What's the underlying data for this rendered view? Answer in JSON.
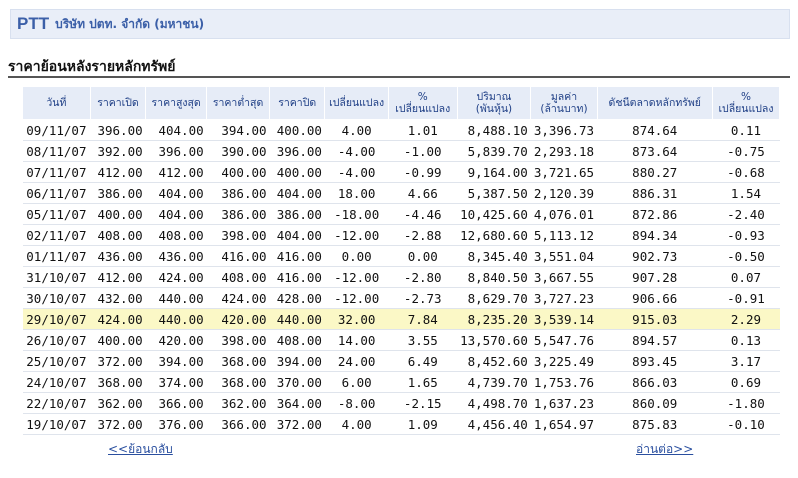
{
  "header": {
    "symbol": "PTT",
    "company_name": "บริษัท ปตท. จำกัด (มหาชน)"
  },
  "section_title": "ราคาย้อนหลังรายหลักทรัพย์",
  "table": {
    "columns": [
      "วันที่",
      "ราคาเปิด",
      "ราคาสูงสุด",
      "ราคาต่ำสุด",
      "ราคาปิด",
      "เปลี่ยนแปลง",
      [
        "%",
        "เปลี่ยนแปลง"
      ],
      [
        "ปริมาณ",
        "(พันหุ้น)"
      ],
      [
        "มูลค่า",
        "(ล้านบาท)"
      ],
      "ดัชนีตลาดหลักทรัพย์",
      [
        "%",
        "เปลี่ยนแปลง"
      ]
    ],
    "highlighted_row": 9,
    "rows": [
      [
        "09/11/07",
        "396.00",
        "404.00",
        "394.00",
        "400.00",
        "4.00",
        "1.01",
        "8,488.10",
        "3,396.73",
        "874.64",
        "0.11"
      ],
      [
        "08/11/07",
        "392.00",
        "396.00",
        "390.00",
        "396.00",
        "-4.00",
        "-1.00",
        "5,839.70",
        "2,293.18",
        "873.64",
        "-0.75"
      ],
      [
        "07/11/07",
        "412.00",
        "412.00",
        "400.00",
        "400.00",
        "-4.00",
        "-0.99",
        "9,164.00",
        "3,721.65",
        "880.27",
        "-0.68"
      ],
      [
        "06/11/07",
        "386.00",
        "404.00",
        "386.00",
        "404.00",
        "18.00",
        "4.66",
        "5,387.50",
        "2,120.39",
        "886.31",
        "1.54"
      ],
      [
        "05/11/07",
        "400.00",
        "404.00",
        "386.00",
        "386.00",
        "-18.00",
        "-4.46",
        "10,425.60",
        "4,076.01",
        "872.86",
        "-2.40"
      ],
      [
        "02/11/07",
        "408.00",
        "408.00",
        "398.00",
        "404.00",
        "-12.00",
        "-2.88",
        "12,680.60",
        "5,113.12",
        "894.34",
        "-0.93"
      ],
      [
        "01/11/07",
        "436.00",
        "436.00",
        "416.00",
        "416.00",
        "0.00",
        "0.00",
        "8,345.40",
        "3,551.04",
        "902.73",
        "-0.50"
      ],
      [
        "31/10/07",
        "412.00",
        "424.00",
        "408.00",
        "416.00",
        "-12.00",
        "-2.80",
        "8,840.50",
        "3,667.55",
        "907.28",
        "0.07"
      ],
      [
        "30/10/07",
        "432.00",
        "440.00",
        "424.00",
        "428.00",
        "-12.00",
        "-2.73",
        "8,629.70",
        "3,727.23",
        "906.66",
        "-0.91"
      ],
      [
        "29/10/07",
        "424.00",
        "440.00",
        "420.00",
        "440.00",
        "32.00",
        "7.84",
        "8,235.20",
        "3,539.14",
        "915.03",
        "2.29"
      ],
      [
        "26/10/07",
        "400.00",
        "420.00",
        "398.00",
        "408.00",
        "14.00",
        "3.55",
        "13,570.60",
        "5,547.76",
        "894.57",
        "0.13"
      ],
      [
        "25/10/07",
        "372.00",
        "394.00",
        "368.00",
        "394.00",
        "24.00",
        "6.49",
        "8,452.60",
        "3,225.49",
        "893.45",
        "3.17"
      ],
      [
        "24/10/07",
        "368.00",
        "374.00",
        "368.00",
        "370.00",
        "6.00",
        "1.65",
        "4,739.70",
        "1,753.76",
        "866.03",
        "0.69"
      ],
      [
        "22/10/07",
        "362.00",
        "366.00",
        "362.00",
        "364.00",
        "-8.00",
        "-2.15",
        "4,498.70",
        "1,637.23",
        "860.09",
        "-1.80"
      ],
      [
        "19/10/07",
        "372.00",
        "376.00",
        "366.00",
        "372.00",
        "4.00",
        "1.09",
        "4,456.40",
        "1,654.97",
        "875.83",
        "-0.10"
      ]
    ]
  },
  "nav": {
    "back_label": "<<ย้อนกลับ",
    "next_label": "อ่านต่อ>>"
  },
  "colors": {
    "brand": "#3b5fa8",
    "header_bg": "#e6ecf7",
    "highlight_bg": "#fbf8c6",
    "link": "#2a4f9f"
  }
}
